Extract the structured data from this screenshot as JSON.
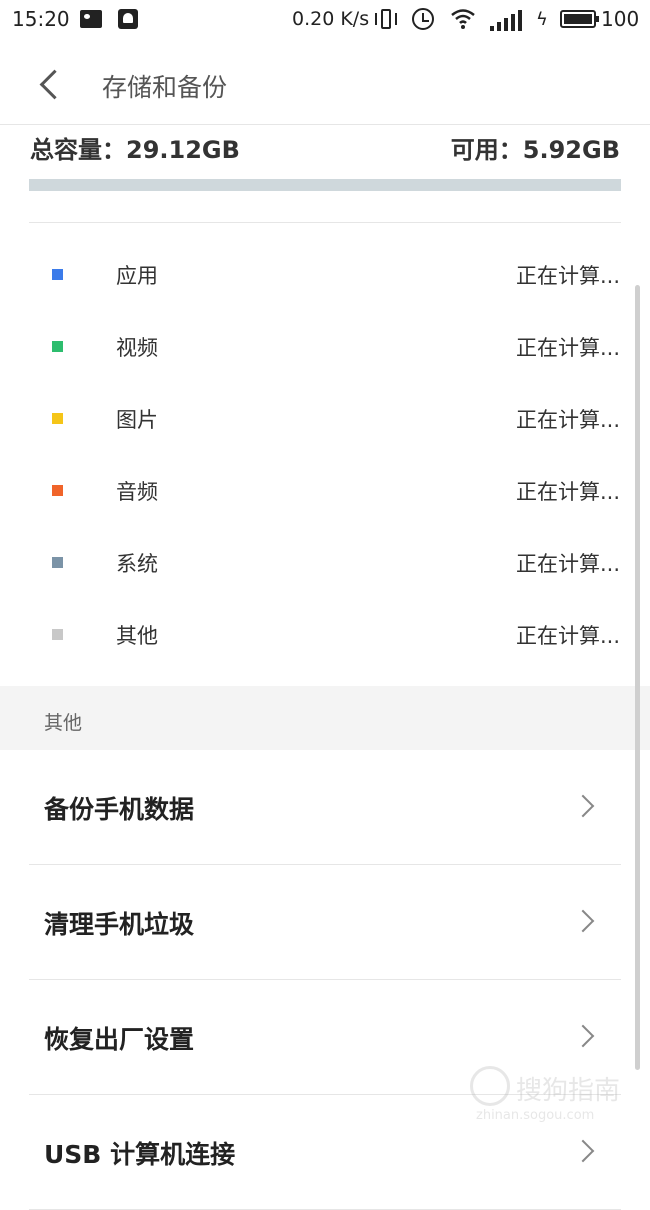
{
  "status_bar": {
    "time": "15:20",
    "net_speed": "0.20 K/s",
    "battery_pct": "100",
    "charging_glyph": "ϟ",
    "icons": [
      "picture-icon",
      "bell-icon",
      "vibrate-icon",
      "alarm-icon",
      "wifi-icon",
      "signal-icon",
      "charging-icon",
      "battery-icon"
    ]
  },
  "header": {
    "title": "存储和备份",
    "back_icon": "back-arrow-icon"
  },
  "storage": {
    "total_text": "总容量：29.12GB",
    "free_text": "可用：5.92GB",
    "bar_color": "#cfd8dc",
    "categories": [
      {
        "label": "应用",
        "value": "正在计算...",
        "color": "#3b7bea"
      },
      {
        "label": "视频",
        "value": "正在计算...",
        "color": "#2dbd6e"
      },
      {
        "label": "图片",
        "value": "正在计算...",
        "color": "#f5c518"
      },
      {
        "label": "音频",
        "value": "正在计算...",
        "color": "#f0642a"
      },
      {
        "label": "系统",
        "value": "正在计算...",
        "color": "#7b93a7"
      },
      {
        "label": "其他",
        "value": "正在计算...",
        "color": "#c8c8c8"
      }
    ]
  },
  "section": {
    "label": "其他"
  },
  "menu": [
    {
      "label": "备份手机数据"
    },
    {
      "label": "清理手机垃圾"
    },
    {
      "label": "恢复出厂设置"
    },
    {
      "label": "USB 计算机连接"
    }
  ],
  "watermark": {
    "text": "搜狗指南",
    "sub": "zhinan.sogou.com"
  }
}
